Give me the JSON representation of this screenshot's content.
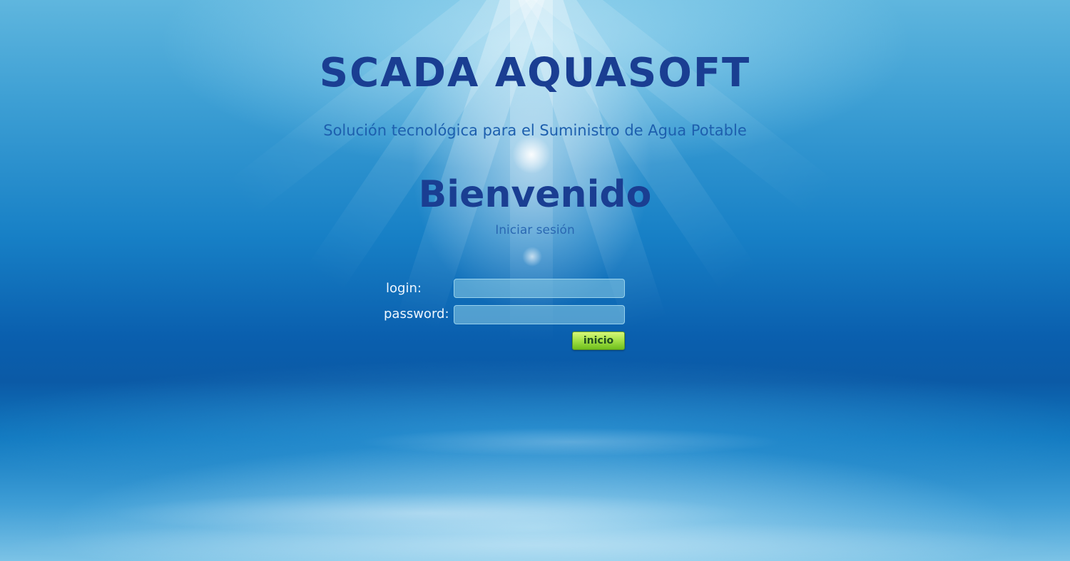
{
  "app": {
    "title": "SCADA AQUASOFT",
    "tagline": "Solución tecnológica para el Suministro de Agua Potable"
  },
  "welcome": {
    "heading": "Bienvenido",
    "subtitle": "Iniciar sesión"
  },
  "form": {
    "login_label": "login:",
    "login_value": "",
    "password_label": "password:",
    "password_value": "",
    "submit_label": "inicio"
  },
  "colors": {
    "title": "#1a3e92",
    "tagline": "#1d5fae",
    "background_deep": "#0a5fae",
    "background_light": "#7cc3e6",
    "button_green": "#a7e34a"
  }
}
